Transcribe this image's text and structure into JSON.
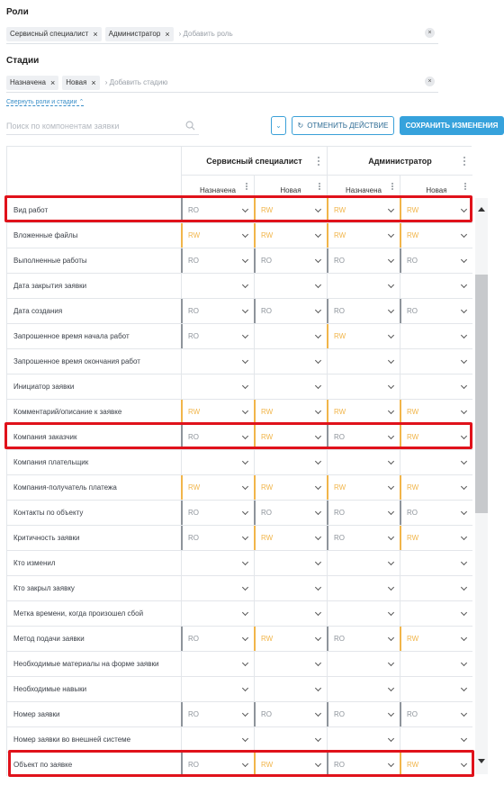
{
  "roles": {
    "label": "Роли",
    "tags": [
      "Сервисный специалист",
      "Администратор"
    ],
    "add_placeholder": "Добавить роль"
  },
  "stages": {
    "label": "Стадии",
    "tags": [
      "Назначена",
      "Новая"
    ],
    "add_placeholder": "Добавить стадию"
  },
  "collapse_link": "Свернуть роли и стадии",
  "search": {
    "placeholder": "Поиск по компонентам заявки"
  },
  "buttons": {
    "undo": "ОТМЕНИТЬ ДЕЙСТВИЕ",
    "save": "СОХРАНИТЬ ИЗМЕНЕНИЯ"
  },
  "table": {
    "role_headers": [
      "Сервисный специалист",
      "Администратор"
    ],
    "stage_headers": [
      "Назначена",
      "Новая",
      "Назначена",
      "Новая"
    ],
    "rows": [
      {
        "name": "Вид работ",
        "cells": [
          "RO",
          "RW",
          "RW",
          "RW"
        ]
      },
      {
        "name": "Вложенные файлы",
        "cells": [
          "RW",
          "RW",
          "RW",
          "RW"
        ]
      },
      {
        "name": "Выполненные работы",
        "cells": [
          "RO",
          "RO",
          "RO",
          "RO"
        ]
      },
      {
        "name": "Дата закрытия заявки",
        "cells": [
          "",
          "",
          "",
          ""
        ]
      },
      {
        "name": "Дата создания",
        "cells": [
          "RO",
          "RO",
          "RO",
          "RO"
        ]
      },
      {
        "name": "Запрошенное время начала работ",
        "cells": [
          "RO",
          "",
          "RW",
          ""
        ]
      },
      {
        "name": "Запрошенное время окончания работ",
        "cells": [
          "",
          "",
          "",
          ""
        ]
      },
      {
        "name": "Инициатор заявки",
        "cells": [
          "",
          "",
          "",
          ""
        ]
      },
      {
        "name": "Комментарий/описание к заявке",
        "cells": [
          "RW",
          "RW",
          "RW",
          "RW"
        ]
      },
      {
        "name": "Компания заказчик",
        "cells": [
          "RO",
          "RW",
          "RO",
          "RW"
        ]
      },
      {
        "name": "Компания плательщик",
        "cells": [
          "",
          "",
          "",
          ""
        ]
      },
      {
        "name": "Компания-получатель платежа",
        "cells": [
          "RW",
          "RW",
          "RW",
          "RW"
        ]
      },
      {
        "name": "Контакты по объекту",
        "cells": [
          "RO",
          "RO",
          "RO",
          "RO"
        ]
      },
      {
        "name": "Критичность заявки",
        "cells": [
          "RO",
          "RW",
          "RO",
          "RW"
        ]
      },
      {
        "name": "Кто изменил",
        "cells": [
          "",
          "",
          "",
          ""
        ]
      },
      {
        "name": "Кто закрыл заявку",
        "cells": [
          "",
          "",
          "",
          ""
        ]
      },
      {
        "name": "Метка времени, когда произошел сбой",
        "cells": [
          "",
          "",
          "",
          ""
        ]
      },
      {
        "name": "Метод подачи заявки",
        "cells": [
          "RO",
          "RW",
          "RO",
          "RW"
        ]
      },
      {
        "name": "Необходимые материалы на форме заявки",
        "cells": [
          "",
          "",
          "",
          ""
        ]
      },
      {
        "name": "Необходимые навыки",
        "cells": [
          "",
          "",
          "",
          ""
        ]
      },
      {
        "name": "Номер заявки",
        "cells": [
          "RO",
          "RO",
          "RO",
          "RO"
        ]
      },
      {
        "name": "Номер заявки во внешней системе",
        "cells": [
          "",
          "",
          "",
          ""
        ]
      },
      {
        "name": "Объект по заявке",
        "cells": [
          "RO",
          "RW",
          "RO",
          "RW"
        ]
      }
    ]
  },
  "colors": {
    "accent": "#36a2dc",
    "ro": "#8e949b",
    "rw": "#f1b54a",
    "highlight": "#e0121b"
  }
}
